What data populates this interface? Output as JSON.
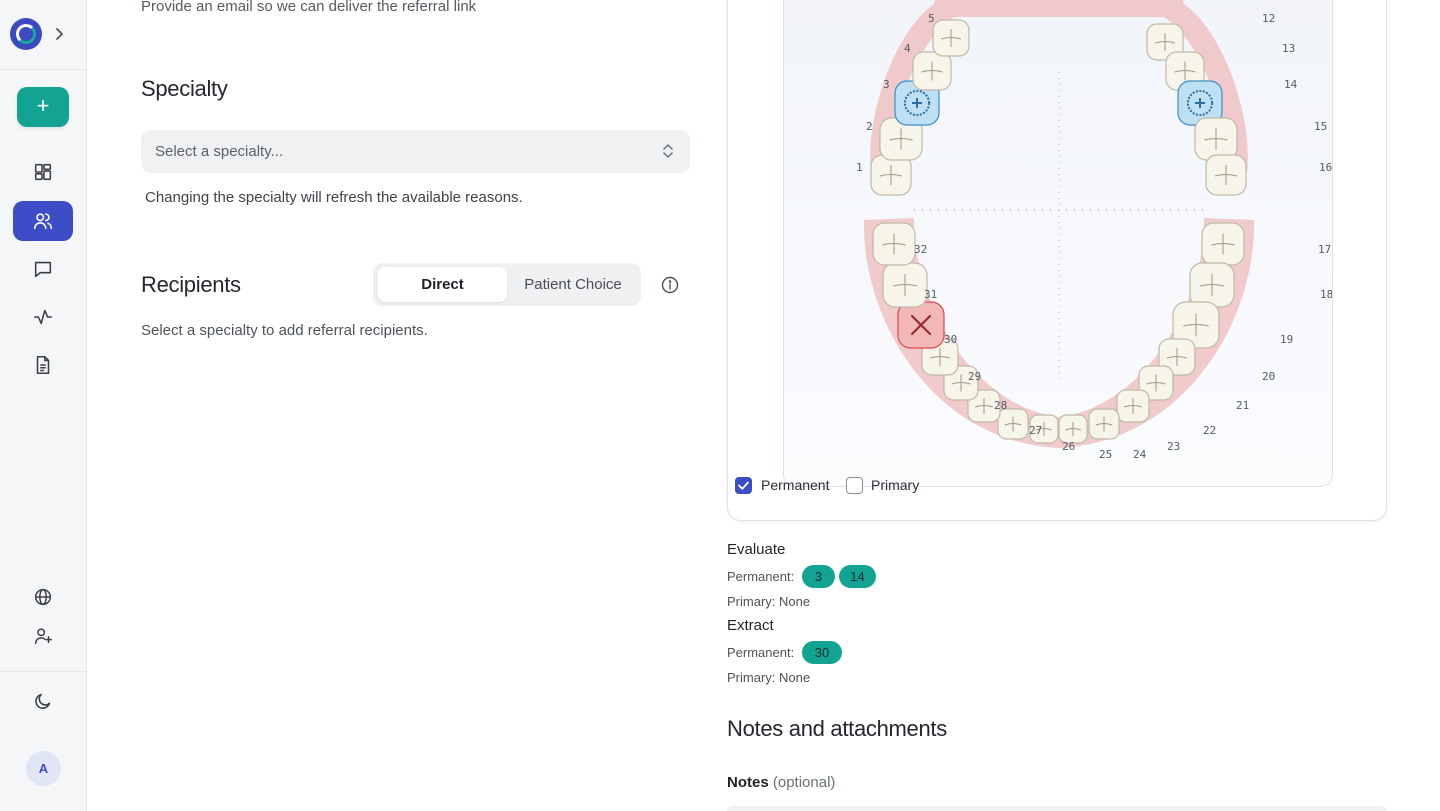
{
  "sidebar": {
    "expand_icon": "chevron-right-icon",
    "add_label": "+",
    "nav": [
      {
        "name": "dashboard",
        "icon": "grid-icon"
      },
      {
        "name": "patients",
        "icon": "users-icon",
        "active": true
      },
      {
        "name": "messages",
        "icon": "message-icon"
      },
      {
        "name": "activity",
        "icon": "activity-icon"
      },
      {
        "name": "documents",
        "icon": "document-icon"
      }
    ],
    "bottom": [
      {
        "name": "language",
        "icon": "globe-icon"
      },
      {
        "name": "invite",
        "icon": "user-plus-icon"
      },
      {
        "name": "theme",
        "icon": "moon-icon"
      }
    ],
    "avatar_initial": "A"
  },
  "form": {
    "email_hint": "Provide an email so we can deliver the referral link",
    "specialty_title": "Specialty",
    "specialty_placeholder": "Select a specialty...",
    "specialty_helper": "Changing the specialty will refresh the available reasons.",
    "recipients_title": "Recipients",
    "recipient_modes": [
      "Direct",
      "Patient Choice"
    ],
    "recipient_mode_selected": "Direct",
    "recipients_helper": "Select a specialty to add referral recipients."
  },
  "tooth_chart": {
    "upper_numbers": [
      "1",
      "2",
      "3",
      "4",
      "5",
      "12",
      "13",
      "14",
      "15",
      "16"
    ],
    "lower_numbers": [
      "17",
      "18",
      "19",
      "20",
      "21",
      "22",
      "23",
      "24",
      "25",
      "26",
      "27",
      "28",
      "29",
      "30",
      "31",
      "32"
    ],
    "evaluate_teeth": [
      "3",
      "14"
    ],
    "extract_teeth": [
      "30"
    ],
    "permanent_label": "Permanent",
    "primary_label": "Primary",
    "permanent_checked": true,
    "primary_checked": false
  },
  "summary": {
    "evaluate_title": "Evaluate",
    "evaluate_permanent_label": "Permanent:",
    "evaluate_permanent": [
      "3",
      "14"
    ],
    "evaluate_primary_label": "Primary:",
    "evaluate_primary": "None",
    "extract_title": "Extract",
    "extract_permanent_label": "Permanent:",
    "extract_permanent": [
      "30"
    ],
    "extract_primary_label": "Primary:",
    "extract_primary": "None"
  },
  "notes": {
    "title": "Notes and attachments",
    "label": "Notes",
    "optional": "(optional)"
  },
  "colors": {
    "accent": "#3d4cc7",
    "teal": "#12a392",
    "extract_red": "#d9474f",
    "evaluate_blue": "#3a8fc9"
  }
}
